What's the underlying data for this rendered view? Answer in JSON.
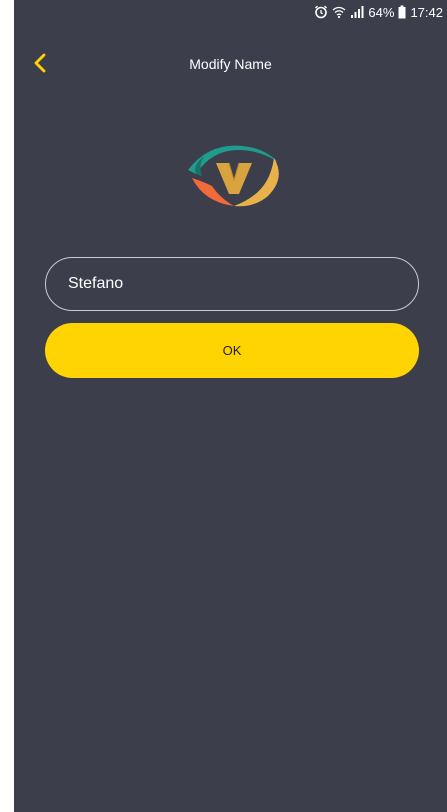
{
  "status_bar": {
    "icons": [
      "alarm-icon",
      "wifi-icon",
      "signal-icon",
      "battery-icon"
    ],
    "battery_percent": "64%",
    "time": "17:42"
  },
  "nav": {
    "back_icon": "chevron-left-icon",
    "title": "Modify Name"
  },
  "logo": {
    "icon": "app-logo-icon",
    "letter": "V"
  },
  "form": {
    "name_value": "Stefano",
    "ok_label": "OK"
  },
  "colors": {
    "background": "#3c3f4b",
    "accent": "#ffd400",
    "logo_teal": "#1f9c8e",
    "logo_orange": "#f26a3a",
    "logo_gold": "#d9a440"
  }
}
